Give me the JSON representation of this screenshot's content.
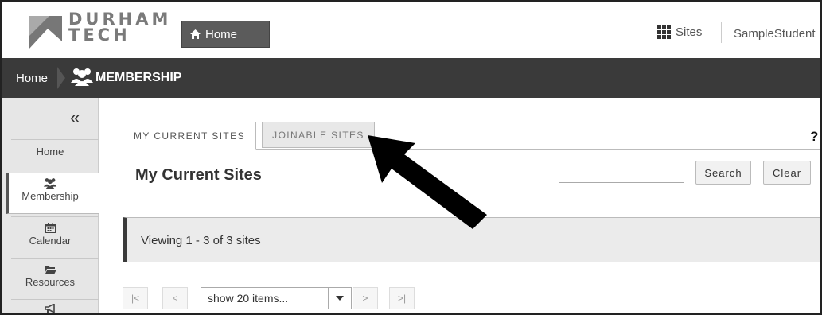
{
  "header": {
    "logo_line1": "DURHAM",
    "logo_line2": "TECH",
    "home_button": "Home",
    "sites_label": "Sites",
    "user_name": "SampleStudent"
  },
  "nav": {
    "breadcrumb_home": "Home",
    "page_title": "MEMBERSHIP"
  },
  "sidebar": {
    "collapse_label": "«",
    "items": [
      {
        "label": "Home",
        "icon": "home"
      },
      {
        "label": "Membership",
        "icon": "users-icon"
      },
      {
        "label": "Calendar",
        "icon": "calendar-icon"
      },
      {
        "label": "Resources",
        "icon": "folder-icon"
      },
      {
        "label": "",
        "icon": "megaphone-icon"
      }
    ]
  },
  "tabs": [
    {
      "label": "MY CURRENT SITES",
      "active": true
    },
    {
      "label": "JOINABLE SITES",
      "active": false
    }
  ],
  "help_label": "?",
  "main": {
    "title": "My Current Sites",
    "search_value": "",
    "search_button": "Search",
    "clear_button": "Clear",
    "viewing_text": "Viewing 1 - 3 of 3 sites"
  },
  "pager": {
    "first": "|<",
    "prev": "<",
    "page_size": "show 20 items...",
    "next": ">",
    "last": ">|"
  },
  "colors": {
    "navbar": "#3a3a3a",
    "sidebar": "#e6e6e6",
    "home_button": "#5b5b5b",
    "annotation_arrow": "#000000"
  }
}
